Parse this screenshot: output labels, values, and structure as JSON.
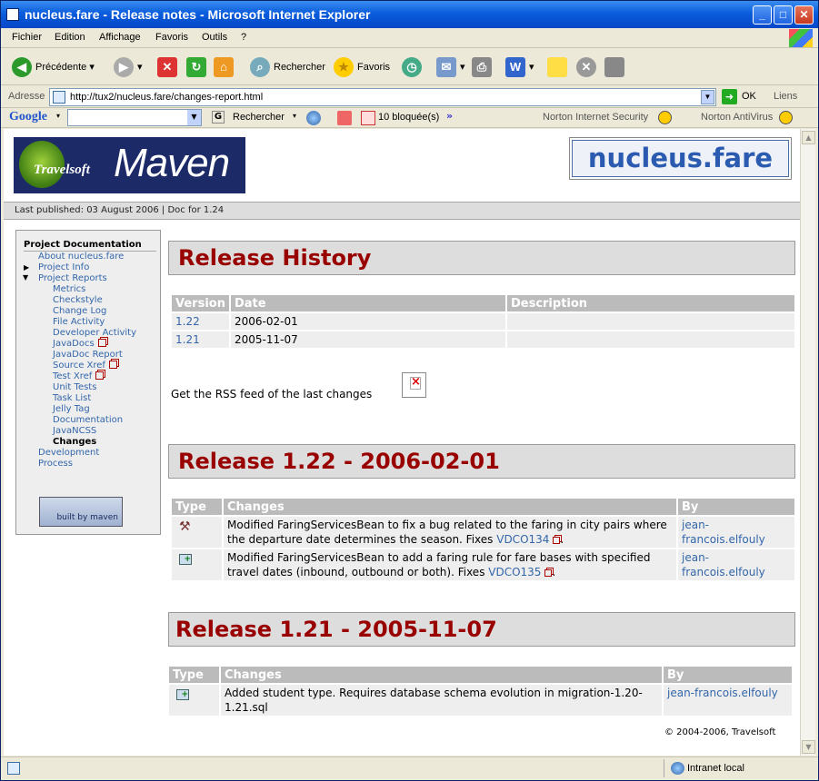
{
  "window": {
    "title": "nucleus.fare - Release notes - Microsoft Internet Explorer",
    "controls": {
      "minimize": "_",
      "maximize": "□",
      "close": "✕"
    }
  },
  "menu": [
    "Fichier",
    "Edition",
    "Affichage",
    "Favoris",
    "Outils",
    "?"
  ],
  "toolbar": {
    "back": "Précédente",
    "search": "Rechercher",
    "favorites": "Favoris"
  },
  "address": {
    "label": "Adresse",
    "url": "http://tux2/nucleus.fare/changes-report.html",
    "go": "OK",
    "links": "Liens"
  },
  "googlebar": {
    "logo": "Google",
    "search": "Rechercher",
    "blocked": "10 bloquée(s)",
    "norton_security": "Norton Internet Security",
    "norton_antivirus": "Norton AntiVirus"
  },
  "page": {
    "maven_logo": {
      "brand": "Travelsoft",
      "product": "Maven"
    },
    "project_logo": "nucleus.fare",
    "published": "Last published: 03 August 2006 | Doc for 1.24",
    "nav_header": "Project Documentation",
    "nav": [
      {
        "label": "About nucleus.fare"
      },
      {
        "label": "Project Info"
      },
      {
        "label": "Project Reports"
      },
      {
        "label": "Metrics"
      },
      {
        "label": "Checkstyle"
      },
      {
        "label": "Change Log"
      },
      {
        "label": "File Activity"
      },
      {
        "label": "Developer Activity"
      },
      {
        "label": "JavaDocs"
      },
      {
        "label": "JavaDoc Report"
      },
      {
        "label": "Source Xref"
      },
      {
        "label": "Test Xref"
      },
      {
        "label": "Unit Tests"
      },
      {
        "label": "Task List"
      },
      {
        "label": "Jelly Tag Documentation"
      },
      {
        "label": "JavaNCSS"
      },
      {
        "label": "Changes"
      },
      {
        "label": "Development Process"
      }
    ],
    "built_by": "built by maven",
    "history": {
      "title": "Release History",
      "headers": [
        "Version",
        "Date",
        "Description"
      ],
      "rows": [
        {
          "version": "1.22",
          "date": "2006-02-01",
          "description": ""
        },
        {
          "version": "1.21",
          "date": "2005-11-07",
          "description": ""
        }
      ]
    },
    "rss": "Get the RSS feed of the last changes",
    "release_122": {
      "title": "Release 1.22 - 2006-02-01",
      "headers": [
        "Type",
        "Changes",
        "By"
      ],
      "rows": [
        {
          "type_icon": "fix-icon",
          "text": "Modified FaringServicesBean to fix a bug related to the faring in city pairs where the departure date determines the season. Fixes ",
          "issue": "VDCO134",
          "by": "jean-francois.elfouly"
        },
        {
          "type_icon": "update-icon",
          "text": "Modified FaringServicesBean to add a faring rule for fare bases with specified travel dates (inbound, outbound or both). Fixes ",
          "issue": "VDCO135",
          "by": "jean-francois.elfouly"
        }
      ]
    },
    "release_121": {
      "title": "Release 1.21 - 2005-11-07",
      "headers": [
        "Type",
        "Changes",
        "By"
      ],
      "rows": [
        {
          "type_icon": "add-icon",
          "text": "Added student type. Requires database schema evolution in migration-1.20-1.21.sql",
          "by": "jean-francois.elfouly"
        }
      ]
    },
    "copyright": "© 2004-2006, Travelsoft"
  },
  "status": {
    "zone": "Intranet local"
  }
}
